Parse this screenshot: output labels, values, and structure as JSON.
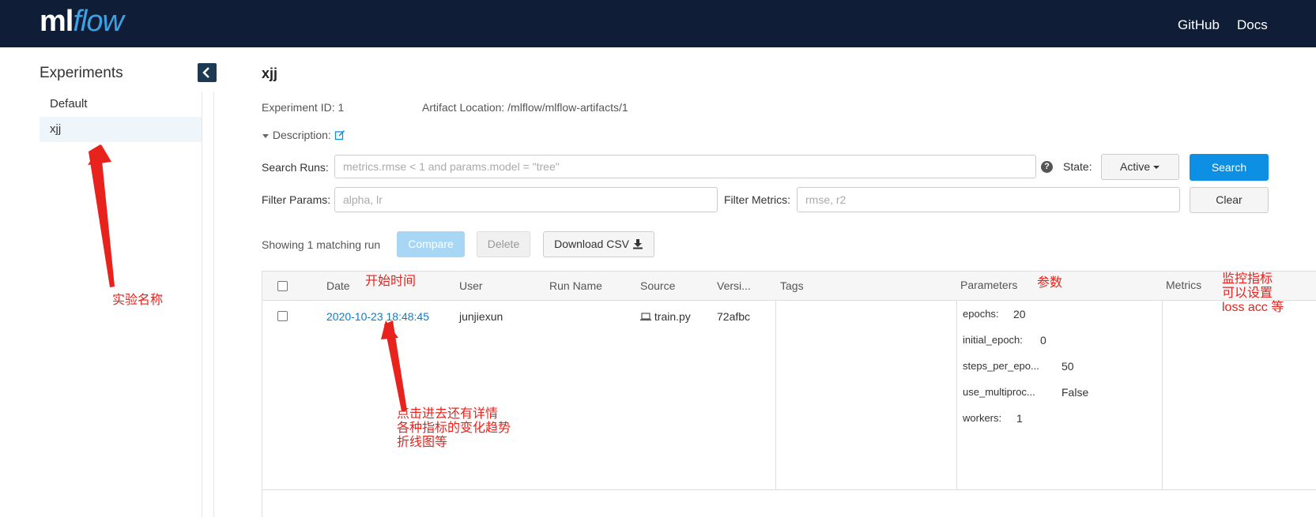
{
  "header": {
    "logo_ml": "ml",
    "logo_flow": "flow",
    "nav": [
      "GitHub",
      "Docs"
    ]
  },
  "sidebar": {
    "title": "Experiments",
    "items": [
      {
        "label": "Default",
        "active": false
      },
      {
        "label": "xjj",
        "active": true
      }
    ]
  },
  "experiment": {
    "name": "xjj",
    "id_text": "Experiment ID: 1",
    "artifact_text": "Artifact Location: /mlflow/mlflow-artifacts/1",
    "description_label": "Description:"
  },
  "search": {
    "runs_label": "Search Runs:",
    "runs_placeholder": "metrics.rmse < 1 and params.model = \"tree\"",
    "help": "?",
    "state_label": "State:",
    "state_value": "Active",
    "search_button": "Search",
    "params_label": "Filter Params:",
    "params_placeholder": "alpha, lr",
    "metrics_label": "Filter Metrics:",
    "metrics_placeholder": "rmse, r2",
    "clear_button": "Clear"
  },
  "toolbar": {
    "count_text": "Showing 1 matching run",
    "compare": "Compare",
    "delete": "Delete",
    "download": "Download CSV"
  },
  "table": {
    "headers": {
      "date": "Date",
      "user": "User",
      "run_name": "Run Name",
      "source": "Source",
      "version": "Versi...",
      "tags": "Tags",
      "parameters": "Parameters",
      "metrics": "Metrics"
    },
    "row": {
      "date": "2020-10-23 18:48:45",
      "user": "junjiexun",
      "run_name": "",
      "source": "train.py",
      "version": "72afbc",
      "params": [
        {
          "key": "epochs:",
          "value": "20"
        },
        {
          "key": "initial_epoch:",
          "value": "0"
        },
        {
          "key": "steps_per_epo...",
          "value": "50"
        },
        {
          "key": "use_multiproc...",
          "value": "False"
        },
        {
          "key": "workers:",
          "value": "1"
        }
      ]
    }
  },
  "annotations": {
    "experiment_name": "实验名称",
    "start_time": "开始时间",
    "params": "参数",
    "metrics": [
      "监控指标",
      "可以设置",
      "loss acc 等"
    ],
    "details": [
      "点击进去还有详情",
      "各种指标的变化趋势",
      "折线图等"
    ]
  },
  "colors": {
    "header_bg": "#0f1e36",
    "primary": "#0d8fe3",
    "link": "#0d7cc8",
    "annotation": "#e8221c"
  }
}
